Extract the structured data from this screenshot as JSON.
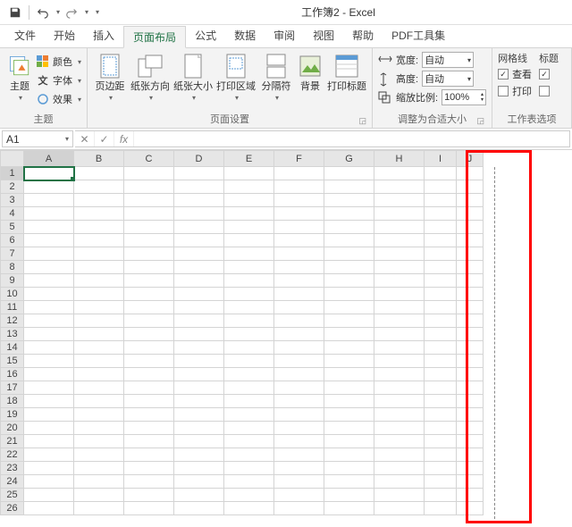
{
  "titlebar": {
    "title": "工作簿2 - Excel"
  },
  "tabs": [
    "文件",
    "开始",
    "插入",
    "页面布局",
    "公式",
    "数据",
    "审阅",
    "视图",
    "帮助",
    "PDF工具集"
  ],
  "active_tab_index": 3,
  "ribbon": {
    "themes": {
      "main": "主题",
      "colors": "颜色",
      "fonts": "字体",
      "effects": "效果",
      "label": "主题"
    },
    "page_setup": {
      "margins": "页边距",
      "orientation": "纸张方向",
      "size": "纸张大小",
      "print_area": "打印区域",
      "breaks": "分隔符",
      "background": "背景",
      "print_titles": "打印标题",
      "label": "页面设置"
    },
    "scale": {
      "width_label": "宽度:",
      "width_value": "自动",
      "height_label": "高度:",
      "height_value": "自动",
      "scale_label": "缩放比例:",
      "scale_value": "100%",
      "label": "调整为合适大小"
    },
    "sheet_options": {
      "gridlines": "网格线",
      "headings": "标题",
      "view": "查看",
      "print": "打印",
      "label": "工作表选项"
    }
  },
  "formula_bar": {
    "name": "A1",
    "fx": "fx"
  },
  "grid": {
    "columns": [
      "A",
      "B",
      "C",
      "D",
      "E",
      "F",
      "G",
      "H",
      "I",
      "J"
    ],
    "rows": 26,
    "selected_cell": "A1"
  }
}
